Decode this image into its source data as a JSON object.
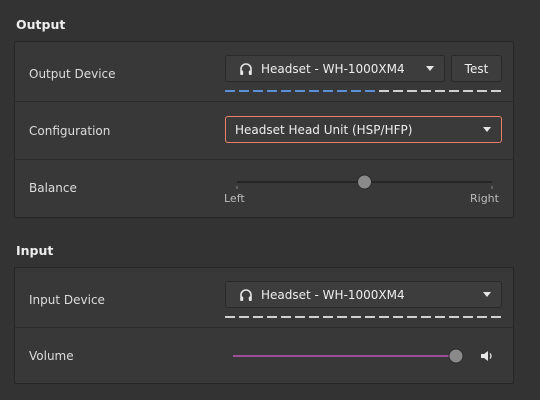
{
  "output": {
    "section_title": "Output",
    "device": {
      "label": "Output Device",
      "selected": "Headset - WH-1000XM4",
      "test_label": "Test",
      "level_fraction": 0.55
    },
    "configuration": {
      "label": "Configuration",
      "selected": "Headset Head Unit (HSP/HFP)"
    },
    "balance": {
      "label": "Balance",
      "left_label": "Left",
      "right_label": "Right",
      "value": 0.5
    }
  },
  "input": {
    "section_title": "Input",
    "device": {
      "label": "Input Device",
      "selected": "Headset - WH-1000XM4",
      "level_fraction": 0.02
    },
    "volume": {
      "label": "Volume",
      "value": 1.0
    }
  },
  "colors": {
    "level_active": "#5b8fd6",
    "level_inactive": "#d0d0d0",
    "level_input_active": "#e9816a",
    "slider_fill": "#9b4f96",
    "focus_border": "#e9816a"
  },
  "icons": {
    "device": "headphones-icon",
    "volume": "speaker-icon"
  }
}
